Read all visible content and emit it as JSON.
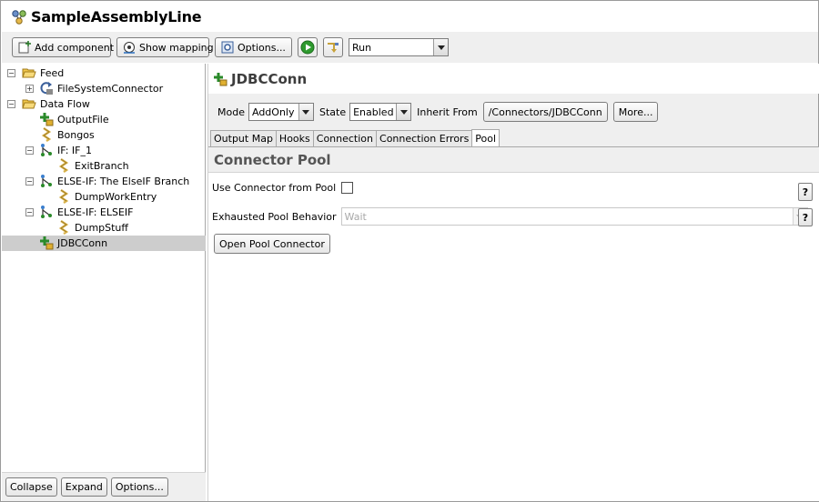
{
  "window": {
    "title": "SampleAssemblyLine"
  },
  "toolbar": {
    "add_component": "Add component",
    "show_mapping": "Show mapping",
    "options": "Options...",
    "run_mode": "Run"
  },
  "tree": {
    "nodes": [
      {
        "label": "Feed",
        "icon": "folder-open-icon",
        "expander": "−"
      },
      {
        "label": "FileSystemConnector",
        "icon": "connector-refresh-icon",
        "expander": "+"
      },
      {
        "label": "Data Flow",
        "icon": "folder-open-icon",
        "expander": "−"
      },
      {
        "label": "OutputFile",
        "icon": "connector-add-icon"
      },
      {
        "label": "Bongos",
        "icon": "script-icon"
      },
      {
        "label": "IF: IF_1",
        "icon": "branch-icon",
        "expander": "−"
      },
      {
        "label": "ExitBranch",
        "icon": "script-icon"
      },
      {
        "label": "ELSE-IF: The ElseIF Branch",
        "icon": "branch-icon",
        "expander": "−"
      },
      {
        "label": "DumpWorkEntry",
        "icon": "script-icon"
      },
      {
        "label": "ELSE-IF: ELSEIF",
        "icon": "branch-icon",
        "expander": "−"
      },
      {
        "label": "DumpStuff",
        "icon": "script-icon"
      },
      {
        "label": "JDBCConn",
        "icon": "connector-add-icon",
        "selected": true
      }
    ]
  },
  "left_footer": {
    "collapse": "Collapse",
    "expand": "Expand",
    "options": "Options..."
  },
  "component": {
    "title": "JDBCConn",
    "mode_label": "Mode",
    "mode_value": "AddOnly",
    "state_label": "State",
    "state_value": "Enabled",
    "inherit_label": "Inherit From",
    "inherit_value": "/Connectors/JDBCConn",
    "more": "More..."
  },
  "tabs": [
    "Output Map",
    "Hooks",
    "Connection",
    "Connection Errors",
    "Pool"
  ],
  "active_tab": "Pool",
  "pool": {
    "section_title": "Connector Pool",
    "use_pool_label": "Use Connector from Pool",
    "use_pool_checked": false,
    "exhausted_label": "Exhausted Pool Behavior",
    "exhausted_value": "Wait",
    "open_pool_button": "Open Pool Connector",
    "help_label": "?"
  },
  "colors": {
    "selection": "#cdcdcd",
    "panel": "#efefef",
    "run_green": "#2e9a2e",
    "folder_yellow": "#f2c84b",
    "script_yellow": "#d8b24a"
  }
}
